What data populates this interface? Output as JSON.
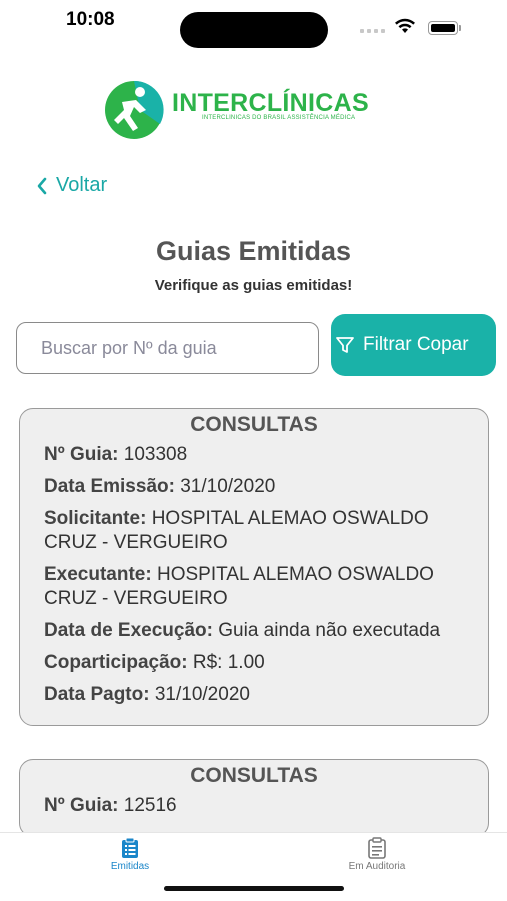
{
  "status_bar": {
    "time": "10:08"
  },
  "brand": {
    "name": "INTERCLÍNICAS",
    "tagline": "INTERCLINICAS DO BRASIL ASSISTÊNCIA MÉDICA",
    "color": "#2db34a"
  },
  "nav": {
    "back_label": "Voltar"
  },
  "header": {
    "title": "Guias Emitidas",
    "subtitle": "Verifique as guias emitidas!"
  },
  "search": {
    "placeholder": "Buscar por Nº da guia",
    "value": ""
  },
  "filter_button": {
    "label": "Filtrar Copar"
  },
  "accent_color": "#1ab2a8",
  "guias": [
    {
      "title": "CONSULTAS",
      "fields": [
        {
          "label": "Nº Guia:",
          "value": "103308"
        },
        {
          "label": "Data Emissão:",
          "value": "31/10/2020"
        },
        {
          "label": "Solicitante:",
          "value": "HOSPITAL ALEMAO OSWALDO CRUZ - VERGUEIRO"
        },
        {
          "label": "Executante:",
          "value": "HOSPITAL ALEMAO OSWALDO CRUZ - VERGUEIRO"
        },
        {
          "label": "Data de Execução:",
          "value": "Guia ainda não executada"
        },
        {
          "label": "Coparticipação:",
          "value": "R$: 1.00"
        },
        {
          "label": "Data Pagto:",
          "value": "31/10/2020"
        }
      ]
    },
    {
      "title": "CONSULTAS",
      "fields": [
        {
          "label": "Nº Guia:",
          "value": "12516"
        }
      ]
    }
  ],
  "tabs": [
    {
      "label": "Emitidas",
      "icon": "clipboard-list-icon",
      "active": true
    },
    {
      "label": "Em Auditoria",
      "icon": "clipboard-icon",
      "active": false
    }
  ]
}
